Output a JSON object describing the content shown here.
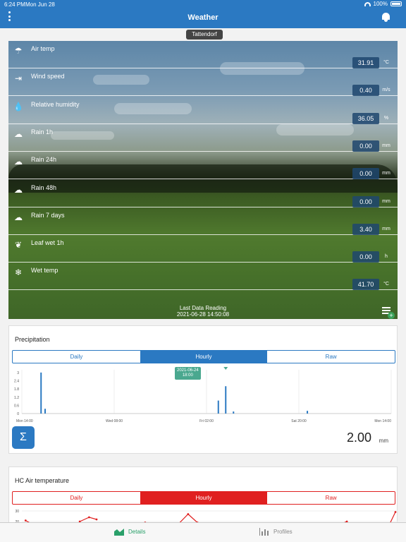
{
  "status_bar": {
    "time": "6:24 PM",
    "date": "Mon Jun 28",
    "battery": "100%"
  },
  "header": {
    "title": "Weather"
  },
  "station": {
    "name": "Tattendorf"
  },
  "sensors": [
    {
      "label": "Air temp",
      "value": "31.91",
      "unit": "°C",
      "icon": "thermometer-icon"
    },
    {
      "label": "Wind speed",
      "value": "0.40",
      "unit": "m/s",
      "icon": "windsock-icon"
    },
    {
      "label": "Relative humidity",
      "value": "36.05",
      "unit": "%",
      "icon": "humidity-drop-icon"
    },
    {
      "label": "Rain 1h",
      "value": "0.00",
      "unit": "mm",
      "icon": "rain-cloud-icon"
    },
    {
      "label": "Rain 24h",
      "value": "0.00",
      "unit": "mm",
      "icon": "rain-cloud-icon"
    },
    {
      "label": "Rain 48h",
      "value": "0.00",
      "unit": "mm",
      "icon": "rain-cloud-icon"
    },
    {
      "label": "Rain 7 days",
      "value": "3.40",
      "unit": "mm",
      "icon": "rain-cloud-icon"
    },
    {
      "label": "Leaf wet 1h",
      "value": "0.00",
      "unit": "h",
      "icon": "leaf-icon"
    },
    {
      "label": "Wet temp",
      "value": "41.70",
      "unit": "°C",
      "icon": "wet-temp-icon"
    }
  ],
  "last_reading": {
    "label": "Last Data Reading",
    "timestamp": "2021-06-28 14:50:08"
  },
  "precipitation_card": {
    "title": "Precipitation",
    "tabs": [
      "Daily",
      "Hourly",
      "Raw"
    ],
    "active_tab": "Hourly",
    "tooltip": {
      "date": "2021-06-24",
      "time": "18:00"
    },
    "total_value": "2.00",
    "total_unit": "mm",
    "accent": "#2b79c2"
  },
  "air_temp_card": {
    "title": "HC Air temperature",
    "tabs": [
      "Daily",
      "Hourly",
      "Raw"
    ],
    "active_tab": "Hourly",
    "accent": "#e02020"
  },
  "tabbar": {
    "details": "Details",
    "profiles": "Profiles",
    "active_color": "#2aa06a"
  },
  "chart_data": [
    {
      "type": "bar",
      "title": "",
      "x_ticks": [
        "Mon 14:00",
        "Wed 08:00",
        "Fri 02:00",
        "Sat 20:00",
        "Mon 14:00"
      ],
      "y_ticks": [
        "3",
        "2.4",
        "1.8",
        "1.2",
        "0.6",
        "0"
      ],
      "ylim": [
        0,
        3.2
      ],
      "grid": true,
      "series": [
        {
          "values": [
            {
              "x": 0.052,
              "y": 3.0
            },
            {
              "x": 0.063,
              "y": 0.35
            },
            {
              "x": 0.532,
              "y": 0.95
            },
            {
              "x": 0.552,
              "y": 2.0
            },
            {
              "x": 0.573,
              "y": 0.15
            },
            {
              "x": 0.773,
              "y": 0.2
            }
          ]
        }
      ]
    },
    {
      "type": "line",
      "title": "",
      "y_ticks": [
        "30",
        "20"
      ],
      "grid": true,
      "series": [
        {
          "values": [
            {
              "x": 0.01,
              "y": 21
            },
            {
              "x": 0.03,
              "y": 17
            },
            {
              "x": 0.155,
              "y": 20
            },
            {
              "x": 0.18,
              "y": 24
            },
            {
              "x": 0.2,
              "y": 22
            },
            {
              "x": 0.3,
              "y": 18
            },
            {
              "x": 0.33,
              "y": 19
            },
            {
              "x": 0.42,
              "y": 18
            },
            {
              "x": 0.445,
              "y": 27
            },
            {
              "x": 0.47,
              "y": 19
            },
            {
              "x": 0.85,
              "y": 17
            },
            {
              "x": 0.87,
              "y": 20
            },
            {
              "x": 0.985,
              "y": 18
            },
            {
              "x": 1.0,
              "y": 29
            }
          ]
        }
      ]
    }
  ]
}
